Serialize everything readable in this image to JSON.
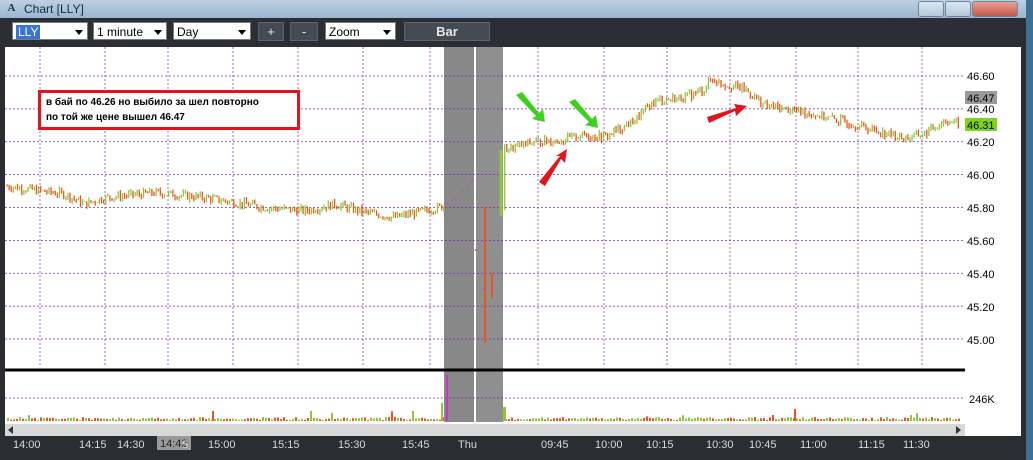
{
  "window": {
    "title": "Chart [LLY]",
    "app_icon_glyph": "A"
  },
  "toolbar": {
    "symbol": "LLY",
    "interval": "1 minute",
    "range": "Day",
    "plus_label": "+",
    "minus_label": "-",
    "zoom_label": "Zoom",
    "chart_type_label": "Bar"
  },
  "annotation": {
    "line1": "в бай по 46.26 но выбило за шел повторно",
    "line2": "по той же цене вышел 46.47"
  },
  "price_axis": {
    "ticks": [
      "46.60",
      "46.40",
      "46.20",
      "46.00",
      "45.80",
      "45.60",
      "45.40",
      "45.20",
      "45.00"
    ],
    "last_price": "46.31",
    "marker_price": "46.47"
  },
  "volume_axis": {
    "label": "246K"
  },
  "time_axis": {
    "labels": [
      "14:00",
      "14:15",
      "14:30",
      "5",
      "15:00",
      "15:15",
      "15:30",
      "15:45",
      "Thu",
      "09:45",
      "10:00",
      "10:15",
      "10:30",
      "10:45",
      "11:00",
      "11:15",
      "11:30"
    ],
    "cursor_time": "14:42"
  },
  "colors": {
    "up_bar": "#8fc63c",
    "down_bar": "#e8551f",
    "premarket_bar": "#cc33cc",
    "gap_shade": "#888888",
    "grid": "#7b2fa3",
    "annotation_border": "#e8101a",
    "arrow_green": "#3fcf1f",
    "arrow_red": "#e0141a",
    "last_price_bg": "#7ed321"
  },
  "icons": [
    "minimize-icon",
    "maximize-icon",
    "close-icon",
    "dropdown-arrow-icon"
  ]
}
